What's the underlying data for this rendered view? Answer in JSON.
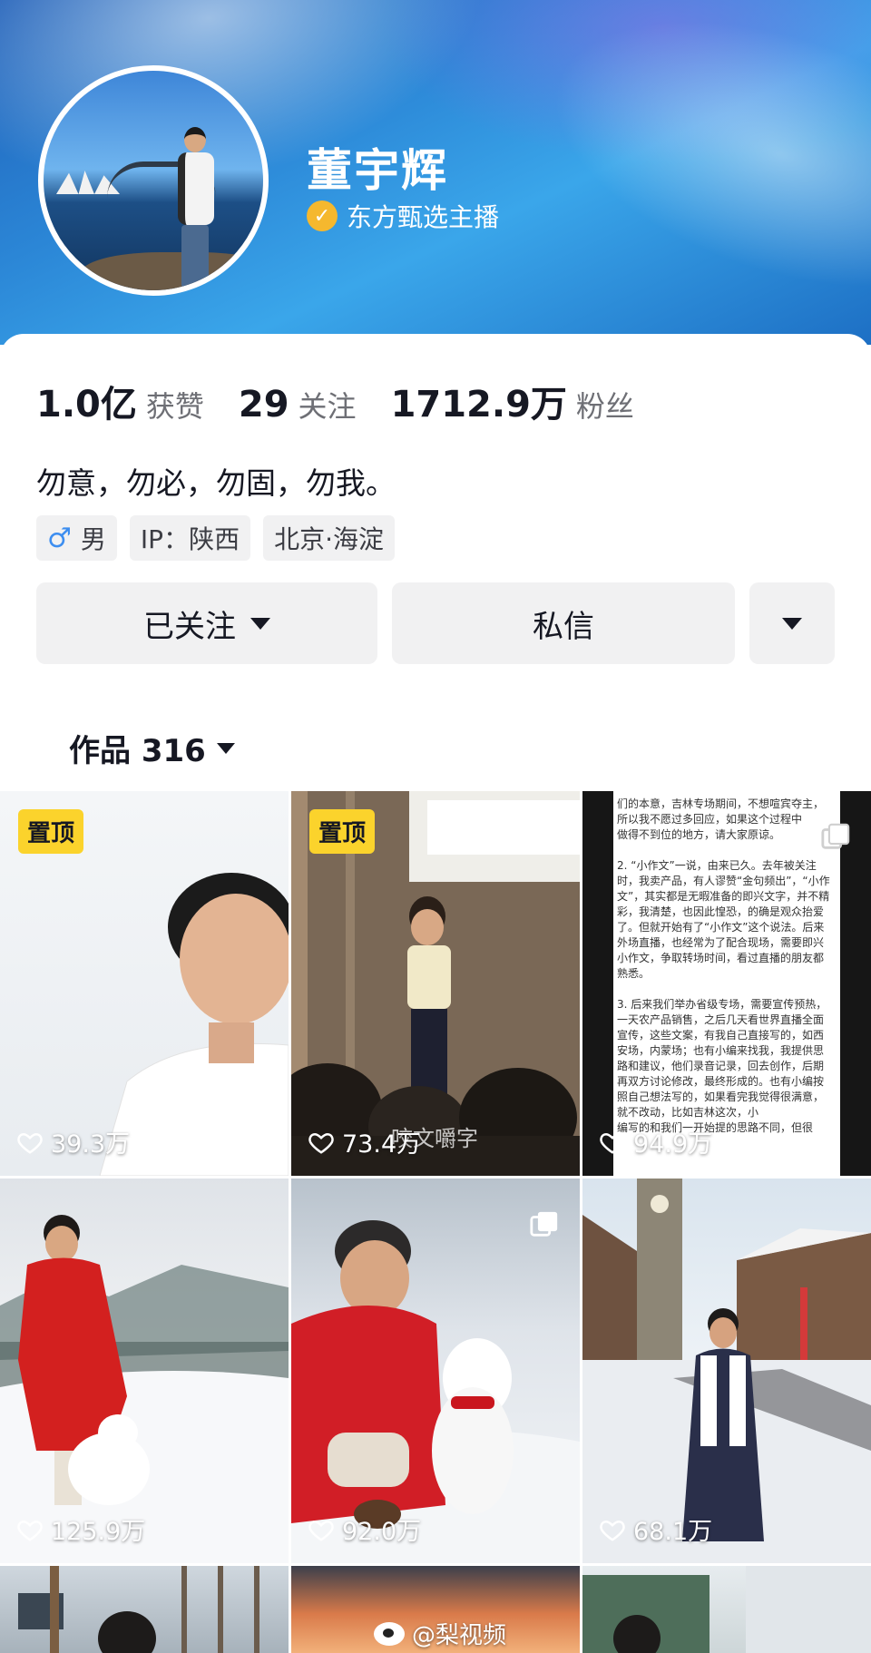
{
  "profile": {
    "name": "董宇辉",
    "verified_label": "东方甄选主播",
    "bio": "勿意，勿必，勿固，勿我。"
  },
  "stats": [
    {
      "value": "1.0亿",
      "label": "获赞"
    },
    {
      "value": "29",
      "label": "关注"
    },
    {
      "value": "1712.9万",
      "label": "粉丝"
    }
  ],
  "tags": {
    "gender": "男",
    "ip": "IP：陕西",
    "location": "北京·海淀"
  },
  "actions": {
    "follow_label": "已关注",
    "message_label": "私信"
  },
  "works": {
    "label": "作品 316"
  },
  "videos": [
    {
      "likes": "39.3万",
      "pinned_label": "置顶"
    },
    {
      "likes": "73.4万",
      "pinned_label": "置顶",
      "overlay_text": "咬文嚼字"
    },
    {
      "likes": "94.9万"
    },
    {
      "likes": "125.9万"
    },
    {
      "likes": "92.0万"
    },
    {
      "likes": "68.1万"
    }
  ],
  "text_post": {
    "lines": [
      "们的本意，吉林专场期间，不想喧宾夺主，",
      "所以我不愿过多回应，如果这个过程中",
      "做得不到位的地方，请大家原谅。",
      "",
      "2. “小作文”一说，由来已久。去年被关注",
      "时，我卖产品，有人谬赞“金句频出”，“小作",
      "文”，其实都是无暇准备的即兴文字，并不精",
      "彩，我清楚，也因此惶恐，的确是观众抬爱",
      "了。但就开始有了“小作文”这个说法。后来",
      "外场直播，也经常为了配合现场，需要即兴",
      "小作文，争取转场时间，看过直播的朋友都",
      "熟悉。",
      "",
      "3. 后来我们举办省级专场，需要宣传预热，",
      "一天农产品销售，之后几天看世界直播全面",
      "宣传，这些文案，有我自己直接写的，如西",
      "安场，内蒙场；也有小编来找我，我提供思",
      "路和建议，他们录音记录，回去创作，后期",
      "再双方讨论修改，最终形成的。也有小编按",
      "照自己想法写的，如果看完我觉得很满意，",
      "就不改动，比如吉林这次，小",
      "编写的和我们一开始提的思路不同，但很"
    ]
  },
  "watermark": "@梨视频",
  "colors": {
    "pin_badge": "#fbd32c",
    "verify_badge": "#f5b82e",
    "button_bg": "#f1f1f2",
    "header_blue": "#2b86d6"
  }
}
